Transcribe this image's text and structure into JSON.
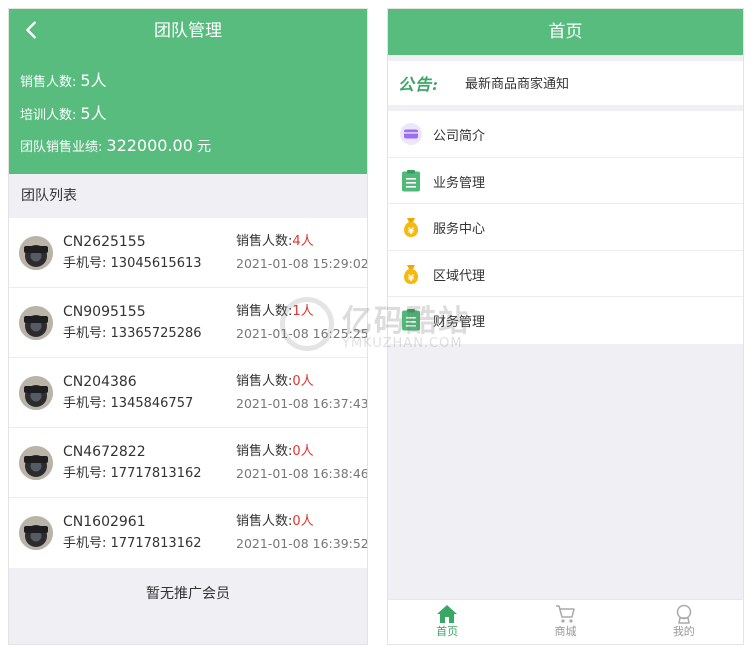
{
  "team_screen": {
    "title": "团队管理",
    "stats": {
      "sales_label": "销售人数:",
      "sales_value": "5人",
      "training_label": "培训人数:",
      "training_value": "5人",
      "performance_label": "团队销售业绩:",
      "performance_value": "322000.00",
      "performance_unit": "元"
    },
    "list_title": "团队列表",
    "members": [
      {
        "code": "CN2625155",
        "phone_label": "手机号:",
        "phone": "13045615613",
        "count_label": "销售人数:",
        "count": "4人",
        "time": "2021-01-08 15:29:02"
      },
      {
        "code": "CN9095155",
        "phone_label": "手机号:",
        "phone": "13365725286",
        "count_label": "销售人数:",
        "count": "1人",
        "time": "2021-01-08 16:25:25"
      },
      {
        "code": "CN204386",
        "phone_label": "手机号:",
        "phone": "1345846757",
        "count_label": "销售人数:",
        "count": "0人",
        "time": "2021-01-08 16:37:43"
      },
      {
        "code": "CN4672822",
        "phone_label": "手机号:",
        "phone": "17717813162",
        "count_label": "销售人数:",
        "count": "0人",
        "time": "2021-01-08 16:38:46"
      },
      {
        "code": "CN1602961",
        "phone_label": "手机号:",
        "phone": "17717813162",
        "count_label": "销售人数:",
        "count": "0人",
        "time": "2021-01-08 16:39:52"
      }
    ],
    "footer_note": "暂无推广会员"
  },
  "home_screen": {
    "title": "首页",
    "notice_label": "公告:",
    "notice_text": "最新商品商家通知",
    "menu": [
      {
        "label": "公司简介",
        "icon": "card-icon"
      },
      {
        "label": "业务管理",
        "icon": "clipboard-icon"
      },
      {
        "label": "服务中心",
        "icon": "money-bag-icon"
      },
      {
        "label": "区域代理",
        "icon": "money-bag-icon"
      },
      {
        "label": "财务管理",
        "icon": "clipboard-icon"
      }
    ],
    "tabs": [
      {
        "label": "首页",
        "icon": "home-icon",
        "active": true
      },
      {
        "label": "商城",
        "icon": "cart-icon",
        "active": false
      },
      {
        "label": "我的",
        "icon": "user-icon",
        "active": false
      }
    ]
  },
  "watermark": {
    "title": "亿码酷站",
    "sub": "YMKUZHAN.COM"
  },
  "colors": {
    "primary_green": "#58bc7f",
    "count_red": "#e0342c",
    "background": "#efeff4"
  }
}
